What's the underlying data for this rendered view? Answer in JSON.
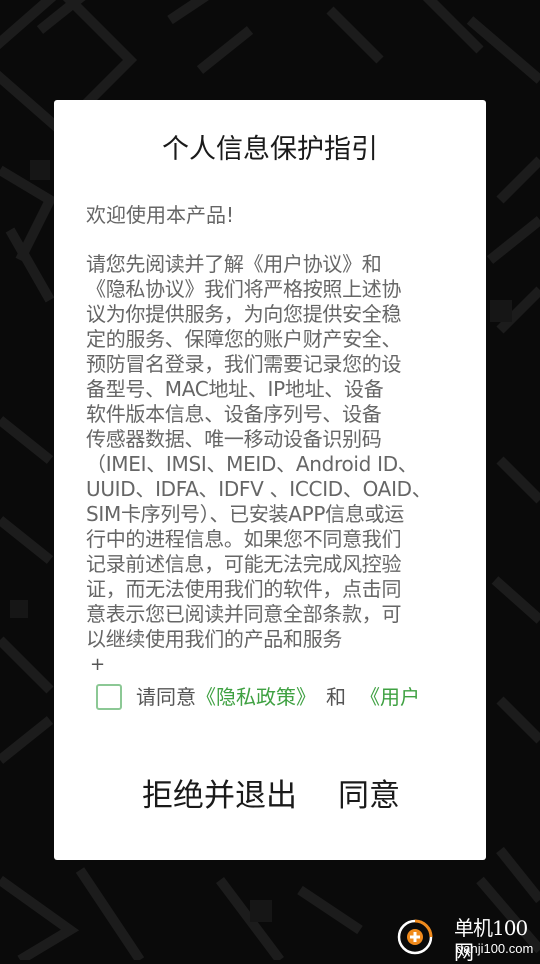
{
  "dialog": {
    "title": "个人信息保护指引",
    "welcome": "欢迎使用本产品!",
    "body_lines": [
      "请您先阅读并了解《用户协议》和",
      "《隐私协议》我们将严格按照上述协",
      "议为你提供服务，为向您提供安全稳",
      "定的服务、保障您的账户财产安全、",
      "预防冒名登录，我们需要记录您的设",
      "备型号、MAC地址、IP地址、设备",
      "软件版本信息、设备序列号、设备",
      "传感器数据、唯一移动设备识别码",
      "（IMEI、IMSI、MEID、Android ID、",
      "UUID、IDFA、IDFV 、ICCID、OAID、",
      "SIM卡序列号）、已安装APP信息或运",
      "行中的进程信息。如果您不同意我们",
      "记录前述信息，可能无法完成风控验",
      "证，而无法使用我们的软件，点击同",
      "意表示您已阅读并同意全部条款，可",
      "以继续使用我们的产品和服务"
    ],
    "plus": "+",
    "consent": {
      "checked": false,
      "prefix": "请同意",
      "privacy_link": "《隐私政策》",
      "and": "和",
      "user_link": "《用户"
    },
    "refuse_label": "拒绝并退出",
    "agree_label": "同意"
  },
  "watermark": {
    "title": "单机100网",
    "url": "danji100.com"
  },
  "colors": {
    "background": "#0a0a0a",
    "dialog": "#ffffff",
    "link": "#3fa142",
    "checkbox_border": "#8cc895",
    "watermark_orange": "#f08a1c"
  }
}
